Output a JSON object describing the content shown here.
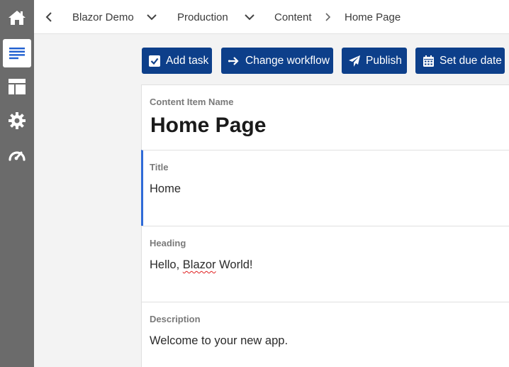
{
  "sidebar": {
    "items": [
      {
        "name": "home",
        "icon": "home-icon"
      },
      {
        "name": "content",
        "icon": "list-icon",
        "active": true
      },
      {
        "name": "layout",
        "icon": "layout-icon"
      },
      {
        "name": "settings",
        "icon": "gear-icon"
      },
      {
        "name": "dashboard",
        "icon": "speedometer-icon"
      }
    ]
  },
  "breadcrumb": {
    "items": [
      "Blazor Demo",
      "Production",
      "Content",
      "Home Page"
    ]
  },
  "toolbar": {
    "add_task": "Add task",
    "change_workflow": "Change workflow",
    "publish": "Publish",
    "set_due_date": "Set due date"
  },
  "content_item": {
    "name_label": "Content Item Name",
    "name": "Home Page",
    "fields": {
      "title": {
        "label": "Title",
        "value": "Home"
      },
      "heading": {
        "label": "Heading",
        "value_prefix": "Hello, ",
        "value_flagged": "Blazor",
        "value_suffix": " World!"
      },
      "description": {
        "label": "Description",
        "value": "Welcome to your new app."
      }
    }
  },
  "colors": {
    "sidebar_bg": "#6b6b6b",
    "primary_button": "#0d3f8a",
    "focus_accent": "#2f6bd8",
    "active_icon": "#1f5fd0"
  }
}
